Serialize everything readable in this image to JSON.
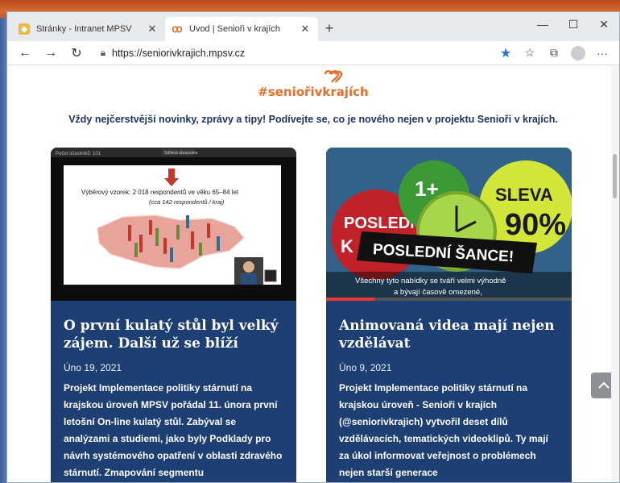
{
  "browser": {
    "tabs": [
      {
        "title": "Stránky - Intranet MPSV",
        "icon": "intranet-favicon"
      },
      {
        "title": "Úvod | Senioři v krajích",
        "icon": "senior-heart-favicon"
      }
    ],
    "url": "https://seniorivkrajich.mpsv.cz"
  },
  "page": {
    "hashtag": "#seniořivkrajích",
    "tagline": "Vždy nejčerstvější novinky, zprávy a tipy! Podívejte se, co je nového nejen v projektu Senioři v krajích."
  },
  "cards": [
    {
      "thumb": {
        "header_left": "Počet účastníků: 101",
        "header_btn": "Sdílená obrazovka",
        "slide_line1": "Výběrový vzorek: 2 018 respondentů ve věku 65–84 let",
        "slide_line2": "(cca 142 respondentů / kraj)"
      },
      "title": "O první kulatý stůl byl velký zájem. Další už se blíží",
      "date": "Úno 19, 2021",
      "text": "Projekt Implementace politiky stárnutí na krajskou úroveň MPSV pořádal 11. února první letošní On-line kulatý stůl. Zabýval se analýzami a studiemi, jako byly Podklady pro návrh systémového opatření v oblasti zdravého stárnutí. Zmapování segmentu"
    },
    {
      "thumb": {
        "overlay_banner": "POSLEDNÍ ŠANCE!",
        "subtitle1": "Všechny tyto nabídky se tváří velmi výhodně",
        "subtitle2": "a bývají časově omezené,",
        "sign_left": "POSLEDN",
        "sign_left2": "K",
        "sign_right": "SLEVA",
        "sign_right2": "90%",
        "sign_top": "1+"
      },
      "title": "Animovaná videa mají nejen vzdělávat",
      "date": "Úno 9, 2021",
      "text": "Projekt Implementace politiky stárnutí na krajskou úroveň  - Senioři v krajích (@seniorivkrajich) vytvořil deset dílů vzdělávacích, tematických videoklipů. Ty mají za úkol informovat veřejnost o problémech nejen starší generace"
    }
  ],
  "colors": {
    "accent": "#e4702e",
    "card_bg": "#1d3f73",
    "tagline": "#1a3561"
  }
}
